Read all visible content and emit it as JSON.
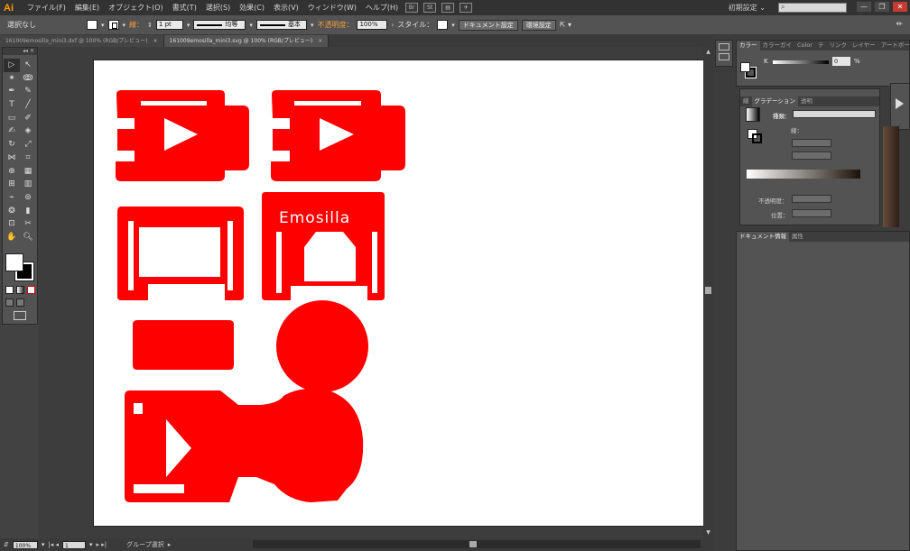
{
  "menubar": {
    "app_logo": "Ai",
    "items": [
      "ファイル(F)",
      "編集(E)",
      "オブジェクト(O)",
      "書式(T)",
      "選択(S)",
      "効果(C)",
      "表示(V)",
      "ウィンドウ(W)",
      "ヘルプ(H)"
    ],
    "icon_br": "Br",
    "icon_st": "St",
    "workspace": "初期設定 ⌄",
    "search_placeholder": ""
  },
  "controlbar": {
    "selection_label": "選択なし",
    "stroke_label": "線：",
    "stroke_weight": "1 pt",
    "stroke_profile": "均等",
    "brush_label": "基本",
    "opacity_label": "不透明度：",
    "opacity_value": "100%",
    "style_label": "スタイル：",
    "doc_setup_button": "ドキュメント設定",
    "prefs_button": "環境設定"
  },
  "tabs": [
    {
      "label": "161009emosilla_mini3.dxf @ 100% (RGB/プレビュー)",
      "active": false
    },
    {
      "label": "161009emosilla_mini3.svg @ 100% (RGB/プレビュー)",
      "active": true
    }
  ],
  "artboard": {
    "text_label": "Emosilla",
    "shape_color": "#ff0000"
  },
  "statusbar": {
    "zoom": "100%",
    "page": "1",
    "status_text": "グループ選択"
  },
  "color_panel": {
    "tabs": [
      "カラー",
      "カラーガイ",
      "Color",
      "テ",
      "リンク",
      "レイヤー",
      "アートボー"
    ],
    "channel_label": "K",
    "channel_value": "0",
    "channel_unit": "%"
  },
  "gradient_panel": {
    "tabs": [
      "線",
      "グラデーション",
      "透明"
    ],
    "type_label": "種類：",
    "stroke_label": "線：",
    "opacity_label": "不透明度：",
    "position_label": "位置："
  },
  "docinfo_panel": {
    "tabs": [
      "ドキュメント情報",
      "属性"
    ]
  }
}
